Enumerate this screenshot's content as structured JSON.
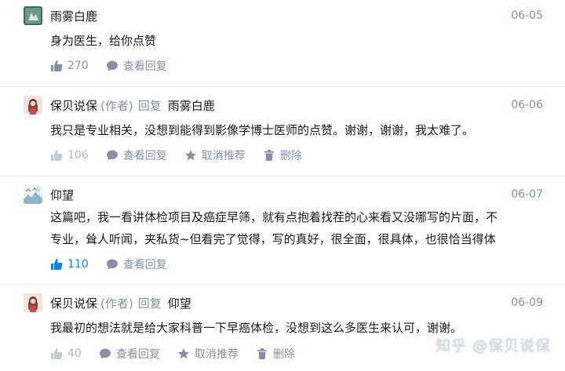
{
  "comments": [
    {
      "author": "雨雾白鹿",
      "date": "06-05",
      "content": "身为医生，给你点赞",
      "likes": "270",
      "view_replies": "查看回复"
    },
    {
      "author": "保贝说保",
      "author_tag": "(作者)",
      "reply_word": "回复",
      "reply_to": "雨雾白鹿",
      "date": "06-06",
      "content": "我只是专业相关，没想到能得到影像学博士医师的点赞。谢谢，谢谢，我太难了。",
      "likes": "106",
      "view_replies": "查看回复",
      "unrecommend": "取消推荐",
      "delete": "删除"
    },
    {
      "author": "仰望",
      "date": "06-07",
      "content_line1": "这篇吧，我一看讲体检项目及癌症早筛，就有点抱着找茬的心来看又没哪写的片面，不",
      "content_line2": "专业，耸人听闻，夹私货~但看完了觉得，写的真好，很全面，很具体，也很恰当得体",
      "likes": "110",
      "view_replies": "查看回复"
    },
    {
      "author": "保贝说保",
      "author_tag": "(作者)",
      "reply_word": "回复",
      "reply_to": "仰望",
      "date": "06-09",
      "content": "我最初的想法就是给大家科普一下早癌体检，没想到这么多医生来认可，谢谢。",
      "likes": "40",
      "view_replies": "查看回复",
      "unrecommend": "取消推荐",
      "delete": "删除"
    }
  ],
  "watermark": "知乎 @保贝说保",
  "colors": {
    "text": "#1a1a1a",
    "meta": "#8590a6",
    "accent": "#0084ff",
    "divider": "#ebebeb"
  },
  "icons": [
    "thumbs-up-icon",
    "speech-bubble-icon",
    "star-icon",
    "trash-icon"
  ]
}
